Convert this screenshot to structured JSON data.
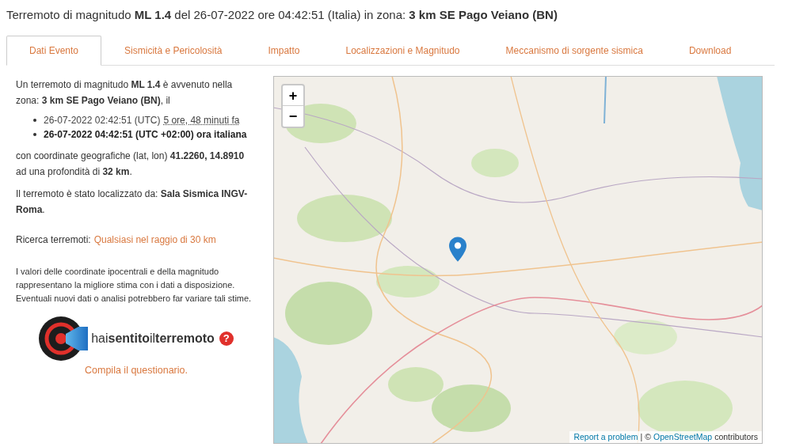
{
  "title": "Terremoto di magnitudo **ML 1.4** del 26-07-2022 ore 04:42:51 (Italia) in zona: **3 km SE Pago Veiano (BN)**",
  "tabs": [
    {
      "label": "Dati Evento",
      "selected": true
    },
    {
      "label": "Sismicità e Pericolosità",
      "selected": false
    },
    {
      "label": "Impatto",
      "selected": false
    },
    {
      "label": "Localizzazioni e Magnitudo",
      "selected": false
    },
    {
      "label": "Meccanismo di sorgente sismica",
      "selected": false
    },
    {
      "label": "Download",
      "selected": false
    }
  ],
  "summary": "Un terremoto di magnitudo **ML 1.4** è avvenuto nella zona: **3 km SE Pago Veiano (BN)**, il",
  "times": [
    {
      "text": "26-07-2022 02:42:51 (UTC)",
      "relative": "5 ore, 48 minuti fa",
      "bold": false
    },
    {
      "text": "26-07-2022 04:42:51 (UTC +02:00) ora italiana",
      "bold": true
    }
  ],
  "coordinates": "con coordinate geografiche (lat, lon) **41.2260, 14.8910** ad una profondità di **32 km**.",
  "located_by": "Il terremoto è stato localizzato da: **Sala Sismica INGV-Roma**.",
  "search": {
    "label": "Ricerca terremoti:",
    "link": "Qualsiasi nel raggio di 30 km"
  },
  "disclaimer": "I valori delle coordinate ipocentrali e della magnitudo rappresentano la migliore stima con i dati a disposizione. Eventuali nuovi dati o analisi potrebbero far variare tali stime.",
  "questionnaire": {
    "logo_text": "hai**sentito**il**terremoto**",
    "help": "?",
    "link": "Compila il questionario."
  },
  "map": {
    "zoom_in": "+",
    "zoom_out": "−",
    "attribution": {
      "report_link": "Report a problem",
      "separator": "|",
      "copyright": "©",
      "osm_link": "OpenStreetMap",
      "suffix": "contributors"
    }
  }
}
